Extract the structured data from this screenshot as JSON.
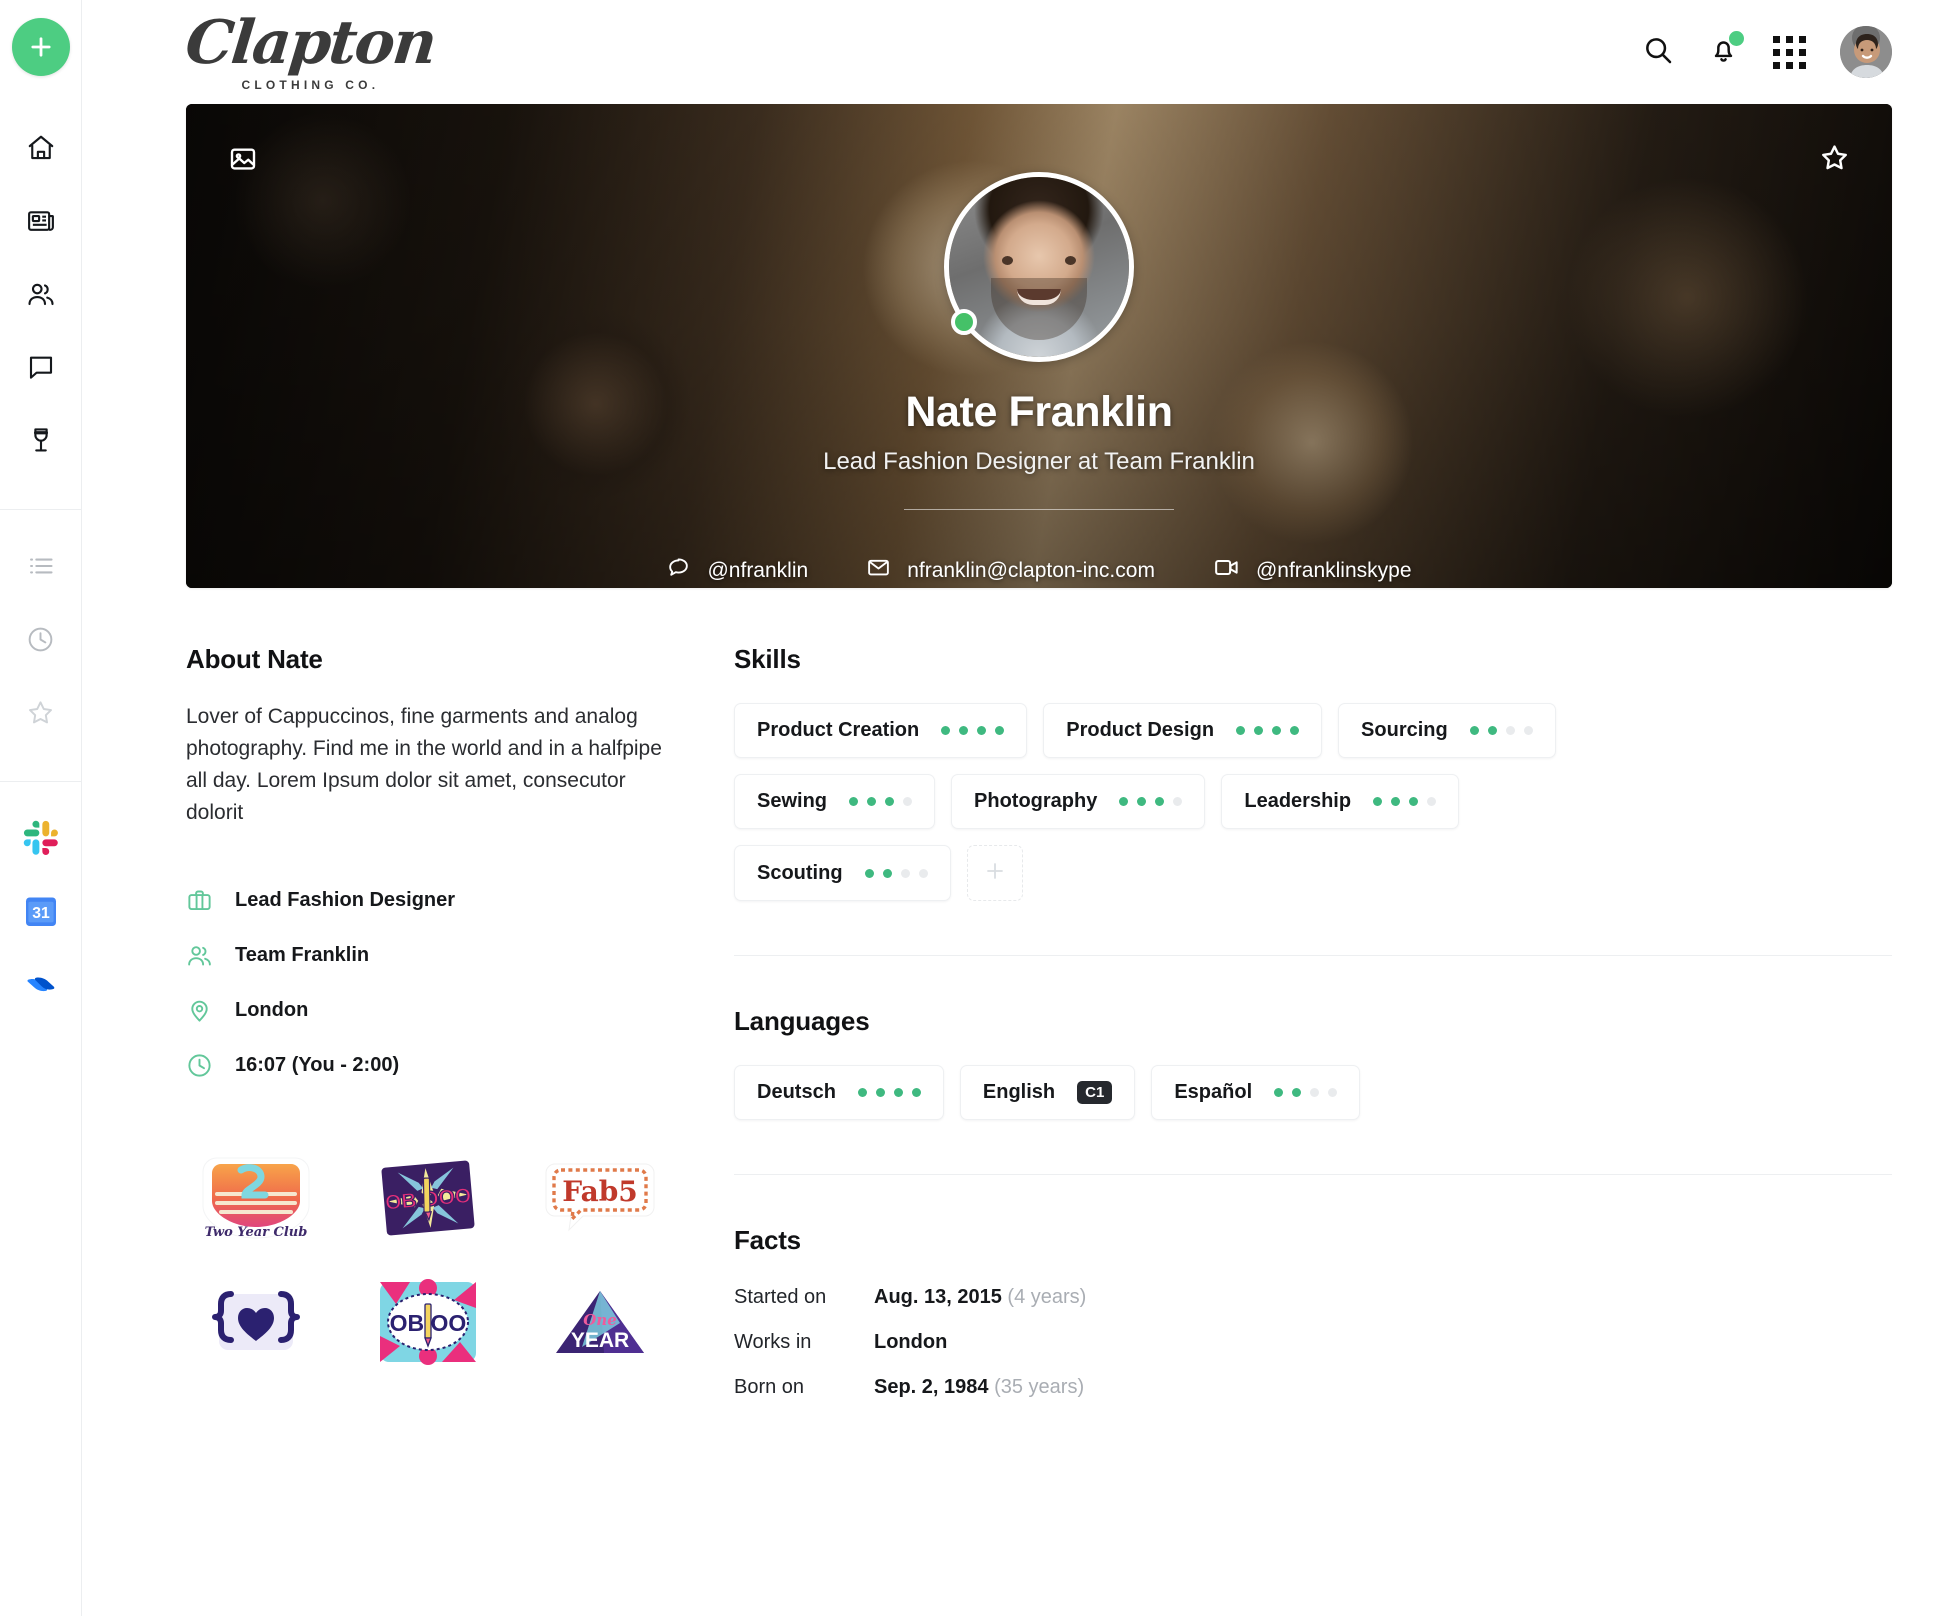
{
  "sidebar": {
    "add_button": {
      "label": "Add",
      "icon": "plus-icon",
      "color": "#4dcd82"
    },
    "primary_items": [
      {
        "name": "home",
        "icon": "home-icon"
      },
      {
        "name": "news",
        "icon": "newspaper-icon"
      },
      {
        "name": "people",
        "icon": "people-icon"
      },
      {
        "name": "chat",
        "icon": "chat-bubble-icon"
      },
      {
        "name": "drinks",
        "icon": "wine-glass-icon"
      }
    ],
    "secondary_items": [
      {
        "name": "list",
        "icon": "list-icon"
      },
      {
        "name": "recent",
        "icon": "clock-icon"
      },
      {
        "name": "favorites",
        "icon": "star-icon"
      }
    ],
    "app_items": [
      {
        "name": "slack",
        "icon": "slack-icon"
      },
      {
        "name": "calendar",
        "icon": "calendar-31-icon",
        "badge": "31"
      },
      {
        "name": "atlassian",
        "icon": "atlassian-icon"
      }
    ]
  },
  "header": {
    "logo_name": "Clapton",
    "logo_tagline": "CLOTHING CO.",
    "actions": [
      {
        "name": "search",
        "icon": "search-icon"
      },
      {
        "name": "notifications",
        "icon": "bell-icon",
        "has_unread": true
      },
      {
        "name": "apps",
        "icon": "grid-apps-icon"
      },
      {
        "name": "account",
        "icon": "avatar"
      }
    ]
  },
  "cover": {
    "image_button": "image-icon",
    "favorite_button": "star-outline-icon",
    "name": "Nate Franklin",
    "role": "Lead Fashion Designer at Team Franklin",
    "status": "online",
    "links": [
      {
        "icon": "chat-bubble-icon",
        "label": "@nfranklin"
      },
      {
        "icon": "envelope-icon",
        "label": "nfranklin@clapton-inc.com"
      },
      {
        "icon": "video-camera-icon",
        "label": "@nfranklinskype"
      }
    ]
  },
  "about": {
    "title": "About Nate",
    "text": "Lover of Cappuccinos, fine garments and analog photography. Find me in the world and in a halfpipe all day. Lorem Ipsum dolor sit amet, consecutor dolorit",
    "facts": [
      {
        "icon": "briefcase-icon",
        "label": "Lead Fashion Designer"
      },
      {
        "icon": "people-icon",
        "label": "Team Franklin"
      },
      {
        "icon": "location-pin-icon",
        "label": "London"
      },
      {
        "icon": "clock-icon",
        "label": "16:07 (You - 2:00)"
      }
    ],
    "badges": [
      {
        "name": "two-year-club-badge",
        "label": "Two Year Club"
      },
      {
        "name": "ob-ooo-burst-badge",
        "label": "OB/OOO"
      },
      {
        "name": "fab5-badge",
        "label": "Fab5"
      },
      {
        "name": "heart-braces-badge",
        "label": "{ heart }"
      },
      {
        "name": "ob-ooo-cloud-badge",
        "label": "OB/OO"
      },
      {
        "name": "one-year-badge",
        "label": "One Year Club"
      }
    ]
  },
  "skills": {
    "title": "Skills",
    "max_level": 4,
    "items": [
      {
        "label": "Product Creation",
        "level": 4
      },
      {
        "label": "Product Design",
        "level": 4
      },
      {
        "label": "Sourcing",
        "level": 2
      },
      {
        "label": "Sewing",
        "level": 3
      },
      {
        "label": "Photography",
        "level": 3
      },
      {
        "label": "Leadership",
        "level": 3
      },
      {
        "label": "Scouting",
        "level": 2
      }
    ],
    "add_label": "+"
  },
  "languages": {
    "title": "Languages",
    "max_level": 4,
    "items": [
      {
        "label": "Deutsch",
        "level": 4
      },
      {
        "label": "English",
        "badge": "C1"
      },
      {
        "label": "Español",
        "level": 2
      }
    ]
  },
  "facts": {
    "title": "Facts",
    "rows": [
      {
        "key": "Started on",
        "value": "Aug. 13, 2015",
        "note": "(4 years)"
      },
      {
        "key": "Works in",
        "value": "London",
        "note": ""
      },
      {
        "key": "Born on",
        "value": "Sep. 2, 1984",
        "note": "(35 years)"
      }
    ]
  },
  "colors": {
    "accent_green": "#4dcd82",
    "dot_green": "#3fb980",
    "text_dark": "#16181b",
    "muted": "#a9adb3"
  }
}
